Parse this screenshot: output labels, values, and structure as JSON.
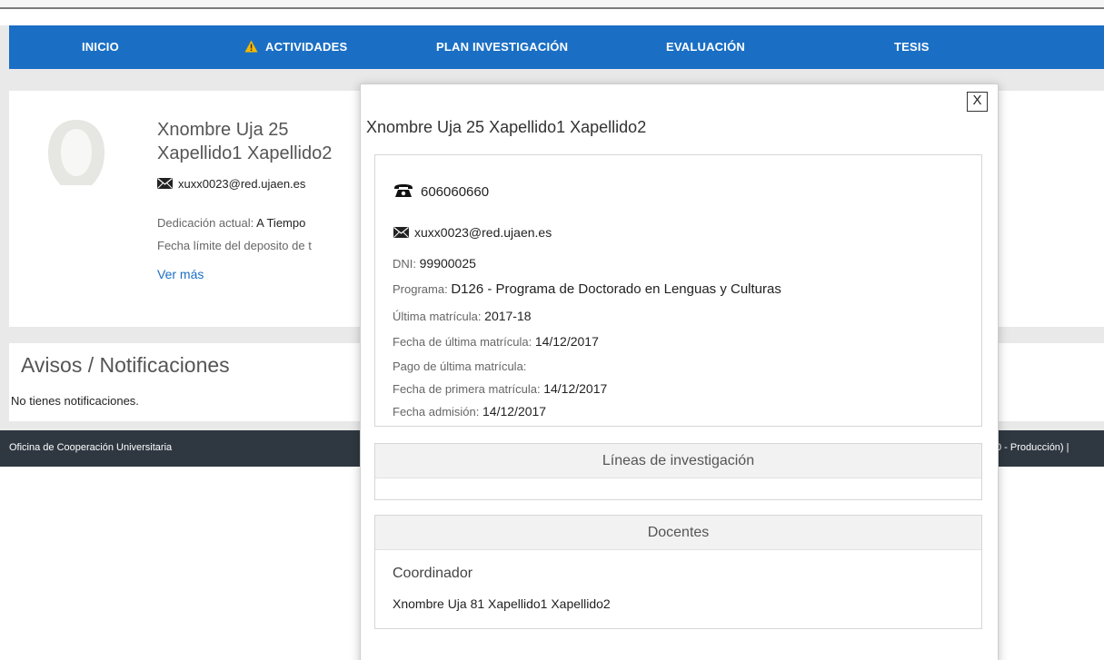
{
  "nav": {
    "items": [
      {
        "label": "INICIO"
      },
      {
        "label": "ACTIVIDADES"
      },
      {
        "label": "PLAN INVESTIGACIÓN"
      },
      {
        "label": "EVALUACIÓN"
      },
      {
        "label": "TESIS"
      }
    ]
  },
  "profile": {
    "name": "Xnombre Uja 25 Xapellido1 Xapellido2",
    "email": "xuxx0023@red.ujaen.es",
    "dedication_label": "Dedicación actual:",
    "dedication_value": "A Tiempo",
    "deadline_label": "Fecha límite del deposito de t",
    "see_more": "Ver más"
  },
  "notifications": {
    "title": "Avisos / Notificaciones",
    "empty": "No tienes notificaciones."
  },
  "footer": {
    "left": "Oficina de Cooperación Universitaria",
    "right": "0 - Producción) |"
  },
  "modal": {
    "close_label": "X",
    "title": "Xnombre Uja 25 Xapellido1 Xapellido2",
    "phone": "606060660",
    "email": "xuxx0023@red.ujaen.es",
    "fields": [
      {
        "label": "DNI:",
        "value": "99900025"
      },
      {
        "label": "Programa:",
        "value": "D126 - Programa de Doctorado en Lenguas y Culturas"
      },
      {
        "label": "Última matrícula:",
        "value": "2017-18"
      },
      {
        "label": "Fecha de última matrícula:",
        "value": "14/12/2017"
      },
      {
        "label": "Pago de última matrícula:",
        "value": ""
      },
      {
        "label": "Fecha de primera matrícula:",
        "value": "14/12/2017"
      },
      {
        "label": "Fecha admisión:",
        "value": "14/12/2017"
      }
    ],
    "lines_header": "Líneas de investigación",
    "teachers_header": "Docentes",
    "teachers_role": "Coordinador",
    "teachers_name": "Xnombre Uja 81 Xapellido1 Xapellido2"
  },
  "colors": {
    "nav_bg": "#1a6fc4",
    "footer_bg": "#2f3841",
    "link": "#1a6fc4",
    "warning": "#f5b800"
  },
  "icons": {
    "warning": "warning-icon",
    "mail": "mail-icon",
    "phone": "phone-icon",
    "avatar": "avatar-icon",
    "close": "close-icon"
  }
}
